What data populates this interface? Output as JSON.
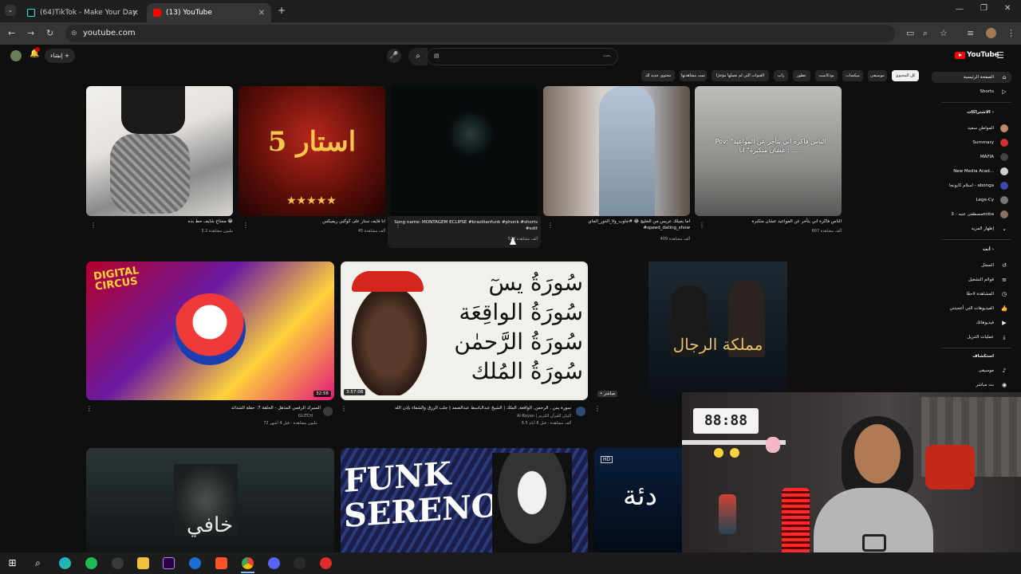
{
  "browser": {
    "tabs": [
      {
        "label": "(64)TikTok - Make Your Day"
      },
      {
        "label": "(13) YouTube"
      }
    ],
    "url": "youtube.com"
  },
  "youtube": {
    "logo_text": "YouTube",
    "create_label": "إنشاء",
    "search_placeholder": "بحث",
    "search_value": "▤",
    "chips": [
      {
        "label": "كل المحتوى",
        "active": true
      },
      {
        "label": "موسيقى"
      },
      {
        "label": "ميكسات"
      },
      {
        "label": "بودكاست"
      },
      {
        "label": "عطور"
      },
      {
        "label": "راب"
      },
      {
        "label": "القنوات التي لم تعملها مؤخرًا"
      },
      {
        "label": "تمت مشاهدتها"
      },
      {
        "label": "محتوى جديد لك"
      }
    ],
    "sidebar": {
      "main": [
        {
          "label": "الصفحة الرئيسية",
          "icon": "home-icon",
          "active": true
        },
        {
          "label": "Shorts",
          "icon": "shorts-icon"
        }
      ],
      "subscriptions_head": "الاشتراكات",
      "subscriptions": [
        {
          "label": "المواطن سعيد",
          "color": "#c0876a"
        },
        {
          "label": "Summary",
          "color": "#d32f2f"
        },
        {
          "label": "MAFIA",
          "color": "#444444"
        },
        {
          "label": "New Media Acad...",
          "color": "#cfcfcf"
        },
        {
          "label": "اسلام كابونجا - abonga",
          "color": "#3949ab"
        },
        {
          "label": "Lege-Cy",
          "color": "#777777"
        },
        {
          "label": "مصطفى عنبه - 3enba",
          "color": "#8d6e63"
        },
        {
          "label": "إظهار المزيد",
          "color": "#0f0f0f"
        }
      ],
      "you_head": "أنت",
      "you": [
        {
          "label": "السجل",
          "icon": "history-icon"
        },
        {
          "label": "قوائم التشغيل",
          "icon": "playlist-icon"
        },
        {
          "label": "المشاهدة لاحقًا",
          "icon": "watch-later-icon"
        },
        {
          "label": "الفيديوهات التي أعجبتني",
          "icon": "like-icon"
        },
        {
          "label": "فيديوهاتك",
          "icon": "your-videos-icon"
        },
        {
          "label": "عمليات التنزيل",
          "icon": "download-icon"
        }
      ],
      "explore_head": "استكشاف",
      "explore": [
        {
          "label": "موسيقى",
          "icon": "music-icon"
        },
        {
          "label": "بث مباشر",
          "icon": "live-icon"
        }
      ]
    },
    "shorts": [
      {
        "title": "محتاج شايف حط بده 😂",
        "views": "3.2 مليون مشاهدة",
        "overlay": ""
      },
      {
        "title": "انا فايف ستار على كوكبي ريميكس",
        "views": "45 ألف مشاهدة",
        "overlay": "5 استار"
      },
      {
        "title": "Song name: MONTAGEM ECLIPSE #brazilianfunk #phonk #shorts #edit",
        "views": "524 ألف مشاهدة",
        "overlay": ""
      },
      {
        "title": "اما يجيلك عريس من الخليج 😂 #جاوب_ولا_الدور_الجاي #speed_dating_show",
        "views": "409 ألف مشاهدة",
        "overlay": ""
      },
      {
        "title": "الناس فاكرة اني بتأخر عن المواعيد عشان متكبرة",
        "views": "607 ألف مشاهدة",
        "overlay": "Pov: \"الناس فاكرة اني بتأخر عن المواعيد عشان متكبرة\" انا : ....."
      }
    ],
    "videos": [
      {
        "title": "السيرك الرقمي المذهل - الحلقة 7: حفلة الشدائد",
        "channel": "GLITCH",
        "meta": "72 مليون مشاهدة - قبل 4 أشهر",
        "duration": "32:56",
        "thumb_text": "DIGITAL CIRCUS"
      },
      {
        "title": "سورة يس , الرحمن, الواقعة, الملك | الشيخ عبدالباسط عبدالصمد | جلب الرزق والشفاء بإذن الله",
        "channel": "Al-Bayan | البيان للقرآن الكريم",
        "meta": "6.5 ألف مشاهدة - قبل 6 أيام",
        "duration": "3:57:08",
        "thumb_text": "سُورَةُ يسٓ سُورَةُ الواقِعَة سُورَةُ الرَّحمٰن سُورَةُ المُلك"
      },
      {
        "title": "",
        "channel": "",
        "meta": "",
        "duration": "• مباشر",
        "thumb_text": "مملكة الرجال"
      }
    ],
    "bottom_thumbs": [
      {
        "text": "خافي"
      },
      {
        "text": "FUNK SERENO"
      },
      {
        "text": "دئة",
        "badge": "HD"
      }
    ],
    "webcam": {
      "clock": "88:88"
    }
  },
  "colors": {
    "accent": "#ff0000",
    "bg": "#0f0f0f"
  }
}
